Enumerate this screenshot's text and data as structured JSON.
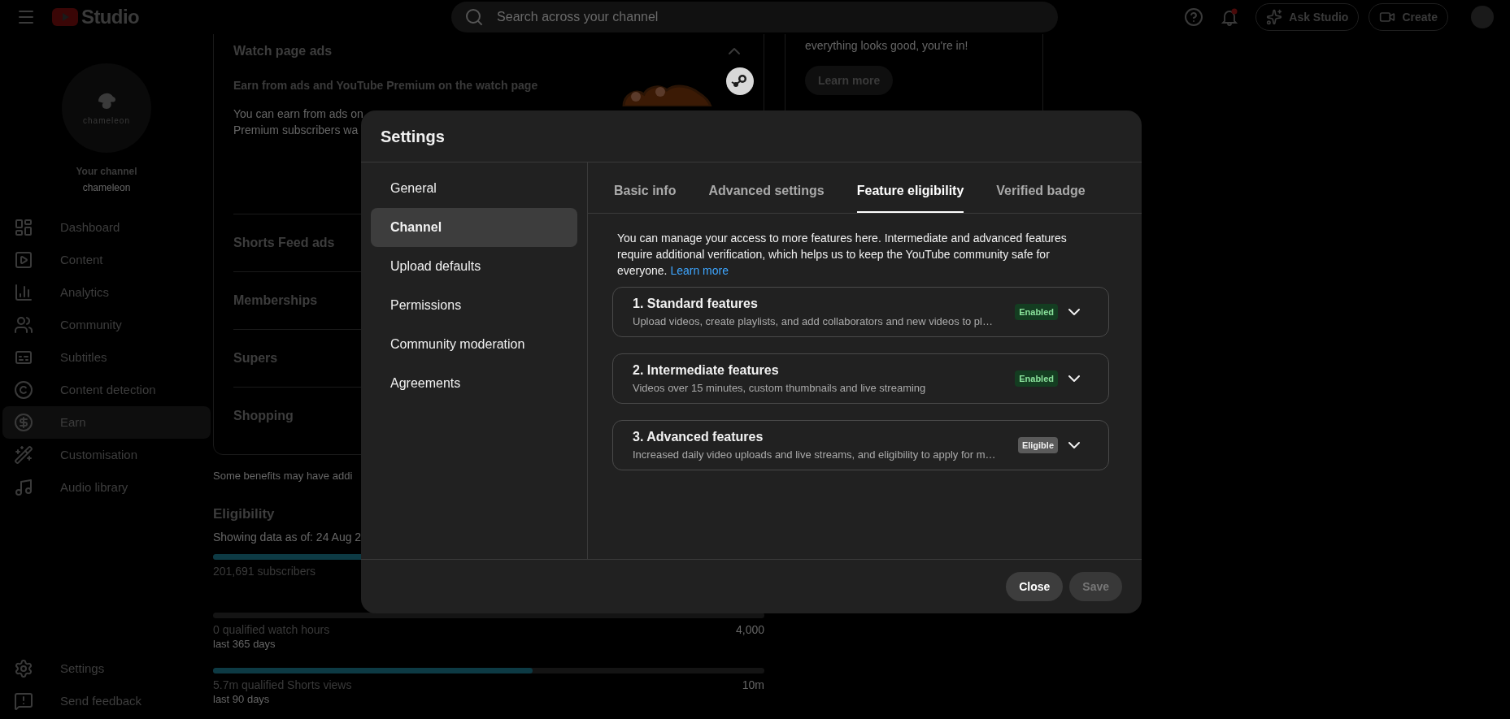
{
  "top_bar": {
    "logo_text": "Studio",
    "search": {
      "placeholder": "Search across your channel"
    },
    "ask_button": "Ask Studio",
    "create_button": "Create"
  },
  "sidebar": {
    "channel": {
      "logo_text": "chameleon",
      "label": "Your channel",
      "name": "chameleon"
    },
    "items": [
      {
        "label": "Dashboard",
        "selected": false
      },
      {
        "label": "Content",
        "selected": false
      },
      {
        "label": "Analytics",
        "selected": false
      },
      {
        "label": "Community",
        "selected": false
      },
      {
        "label": "Subtitles",
        "selected": false
      },
      {
        "label": "Content detection",
        "selected": false
      },
      {
        "label": "Earn",
        "selected": true
      },
      {
        "label": "Customisation",
        "selected": false
      },
      {
        "label": "Audio library",
        "selected": false
      }
    ],
    "bottom_items": [
      {
        "label": "Settings"
      },
      {
        "label": "Send feedback"
      }
    ]
  },
  "monetization_card": {
    "sections": [
      {
        "title": "Watch page ads",
        "expanded": true,
        "subtitle": "Earn from ads and YouTube Premium on the watch page",
        "body_lines": [
          "You can earn from ads on",
          "Premium subscribers wa"
        ]
      },
      {
        "title": "Shorts Feed ads",
        "expanded": false
      },
      {
        "title": "Memberships",
        "expanded": false
      },
      {
        "title": "Supers",
        "expanded": false
      },
      {
        "title": "Shopping",
        "expanded": false
      }
    ]
  },
  "note": "Some benefits may have addi",
  "eligibility": {
    "title": "Eligibility",
    "date": "Showing data as of: 24 Aug 2",
    "metrics": [
      {
        "label": "201,691 subscribers",
        "level": 1
      },
      {
        "label": "0 qualified watch hours",
        "target": "4,000",
        "period": "last 365 days",
        "level": 0
      },
      {
        "label": "5.7m qualified Shorts views",
        "target": "10m",
        "period": "last 90 days",
        "level": 0.58
      }
    ]
  },
  "status_card": {
    "text": "everything looks good, you're in!",
    "button": "Learn more"
  },
  "modal": {
    "title": "Settings",
    "nav": [
      {
        "label": "General",
        "selected": false
      },
      {
        "label": "Channel",
        "selected": true
      },
      {
        "label": "Upload defaults",
        "selected": false
      },
      {
        "label": "Permissions",
        "selected": false
      },
      {
        "label": "Community moderation",
        "selected": false
      },
      {
        "label": "Agreements",
        "selected": false
      }
    ],
    "tabs": [
      {
        "label": "Basic info",
        "selected": false
      },
      {
        "label": "Advanced settings",
        "selected": false
      },
      {
        "label": "Feature eligibility",
        "selected": true
      },
      {
        "label": "Verified badge",
        "selected": false
      }
    ],
    "intro": "You can manage your access to more features here. Intermediate and advanced features require additional verification, which helps us to keep the YouTube community safe for everyone.",
    "intro_link": "Learn more",
    "features": [
      {
        "title": "1. Standard features",
        "description": "Upload videos, create playlists, and add collaborators and new videos to pl…",
        "status": "Enabled",
        "kind": "enabled"
      },
      {
        "title": "2. Intermediate features",
        "description": "Videos over 15 minutes, custom thumbnails and live streaming",
        "status": "Enabled",
        "kind": "enabled"
      },
      {
        "title": "3. Advanced features",
        "description": "Increased daily video uploads and live streams, and eligibility to apply for m…",
        "status": "Eligible",
        "kind": "eligible"
      }
    ],
    "buttons": {
      "close": "Close",
      "save": "Save",
      "save_disabled": true
    }
  }
}
